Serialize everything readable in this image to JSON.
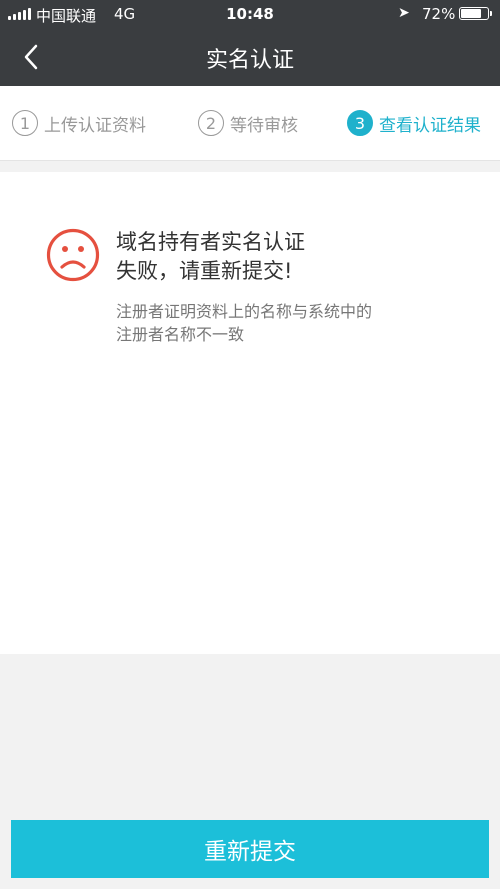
{
  "status_bar": {
    "carrier": "中国联通",
    "network": "4G",
    "time": "10:48",
    "battery": "72%",
    "icons": [
      "signal-icon",
      "location-arrow-icon",
      "battery-icon"
    ]
  },
  "nav": {
    "title": "实名认证",
    "back_icon": "chevron-left-icon"
  },
  "steps": [
    {
      "number": "1",
      "label": "上传认证资料",
      "active": false
    },
    {
      "number": "2",
      "label": "等待审核",
      "active": false
    },
    {
      "number": "3",
      "label": "查看认证结果",
      "active": true
    }
  ],
  "result": {
    "icon": "sad-face-icon",
    "title_line1": "域名持有者实名认证",
    "title_line2": "失败，请重新提交!",
    "desc_line1": "注册者证明资料上的名称与系统中的",
    "desc_line2": "注册者名称不一致"
  },
  "actions": {
    "resubmit_label": "重新提交"
  },
  "colors": {
    "header_bg": "#3a3d40",
    "accent": "#1fb1cc",
    "button_bg": "#1cbfd9",
    "error": "#e5503f"
  }
}
